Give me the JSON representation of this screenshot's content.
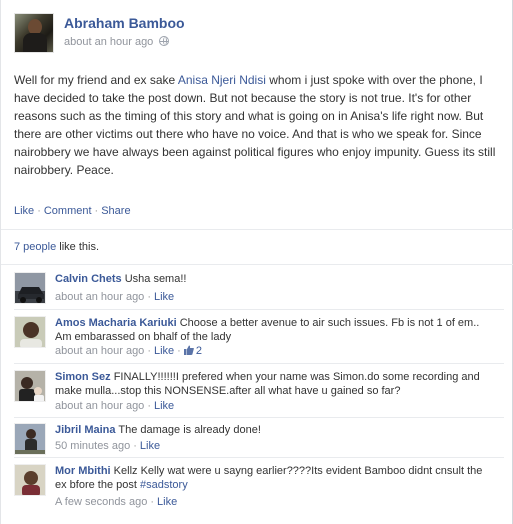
{
  "post": {
    "author": "Abraham Bamboo",
    "time": "about an hour ago",
    "body_before": "Well for my friend and ex sake ",
    "mention": "Anisa Njeri Ndisi",
    "body_after": " whom i just spoke with over the phone, I have decided to take the post down. But not because the story is not true. It's for other reasons such as the timing of this story and what is going on in Anisa's life right now. But there are other victims out there who have no voice. And that is who we speak for. Since nairobbery we have always been against political figures who enjoy impunity. Guess its still nairobbery. Peace."
  },
  "actions": {
    "like": "Like",
    "comment": "Comment",
    "share": "Share",
    "separator": "·"
  },
  "likes": {
    "count_text": "7 people",
    "suffix": " like this."
  },
  "comments": [
    {
      "name": "Calvin Chets",
      "text": "Usha sema!!",
      "time": "about an hour ago",
      "like": "Like"
    },
    {
      "name": "Amos Macharia Kariuki",
      "text": "Choose a better avenue to air such issues. Fb is not 1 of em.. Am embarassed on bhalf of the lady",
      "time": "about an hour ago",
      "like": "Like",
      "likes_count": "2"
    },
    {
      "name": "Simon Sez",
      "text": "FINALLY!!!!!!I prefered when your name was Simon.do some recording and make mulla...stop this NONSENSE.after all what have u gained so far?",
      "time": "about an hour ago",
      "like": "Like"
    },
    {
      "name": "Jibril Maina",
      "text": "The damage is already done!",
      "time": "50 minutes ago",
      "like": "Like"
    },
    {
      "name": "Mor Mbithi",
      "text": "Kellz Kelly wat were u sayng earlier????Its evident Bamboo didnt cnsult the ex bfore the post ",
      "tag": "#sadstory",
      "time": "A few seconds ago",
      "like": "Like"
    }
  ],
  "colors": {
    "link": "#3b5998",
    "meta": "#90949c",
    "divider": "#e9ebee"
  }
}
